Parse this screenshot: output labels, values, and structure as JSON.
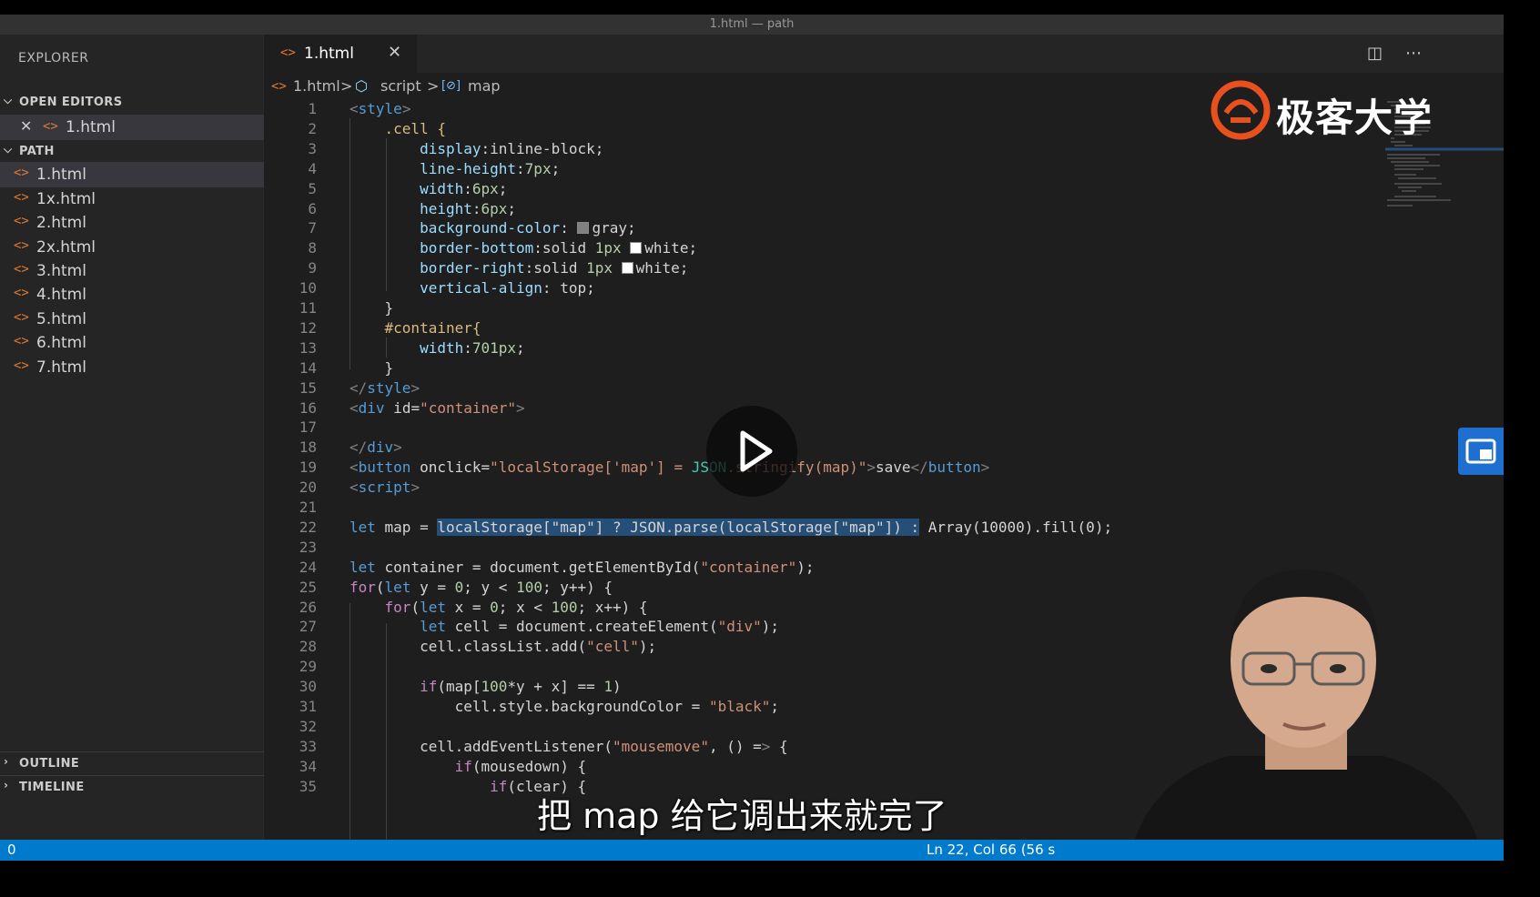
{
  "window": {
    "title": "1.html — path"
  },
  "sidebar": {
    "header": "EXPLORER",
    "open_editors": {
      "label": "OPEN EDITORS",
      "file": "1.html"
    },
    "folder": {
      "label": "PATH",
      "files": [
        "1.html",
        "1x.html",
        "2.html",
        "2x.html",
        "3.html",
        "4.html",
        "5.html",
        "6.html",
        "7.html"
      ]
    },
    "outline_label": "OUTLINE",
    "timeline_label": "TIMELINE"
  },
  "tab": {
    "label": "1.html"
  },
  "breadcrumb": {
    "file": "1.html",
    "sep1": ">",
    "item1": "script",
    "sep2": ">",
    "item2": "map"
  },
  "editor": {
    "line_numbers": [
      "1",
      "2",
      "3",
      "4",
      "5",
      "6",
      "7",
      "8",
      "9",
      "10",
      "11",
      "12",
      "13",
      "14",
      "15",
      "16",
      "17",
      "18",
      "19",
      "20",
      "21",
      "22",
      "23",
      "24",
      "25",
      "26",
      "27",
      "28",
      "29",
      "30",
      "31",
      "32",
      "33",
      "34",
      "35"
    ],
    "lines": [
      "<style>",
      "    .cell {",
      "        display:inline-block;",
      "        line-height:7px;",
      "        width:6px;",
      "        height:6px;",
      "        background-color: gray;",
      "        border-bottom:solid 1px white;",
      "        border-right:solid 1px white;",
      "        vertical-align: top;",
      "    }",
      "    #container{",
      "        width:701px;",
      "    }",
      "</style>",
      "<div id=\"container\">",
      "",
      "</div>",
      "<button onclick=\"localStorage['map'] = JSON.stringify(map)\">save</button>",
      "<script>",
      "",
      "let map = localStorage[\"map\"] ? JSON.parse(localStorage[\"map\"]) : Array(10000).fill(0);",
      "",
      "let container = document.getElementById(\"container\");",
      "for(let y = 0; y < 100; y++) {",
      "    for(let x = 0; x < 100; x++) {",
      "        let cell = document.createElement(\"div\");",
      "        cell.classList.add(\"cell\");",
      "",
      "        if(map[100*y + x] == 1)",
      "            cell.style.backgroundColor = \"black\";",
      "",
      "        cell.addEventListener(\"mousemove\", () => {",
      "            if(mousedown) {",
      "                if(clear) {"
    ]
  },
  "logo": {
    "text": "极客大学",
    "accent": "#e8501e"
  },
  "subtitle": "把 map 给它调出来就完了",
  "statusbar": {
    "left": "0",
    "position": "Ln 22, Col 66 (56 s"
  },
  "colors": {
    "status": "#007acc",
    "editor_bg": "#1e1e1e",
    "sidebar_bg": "#252526"
  }
}
